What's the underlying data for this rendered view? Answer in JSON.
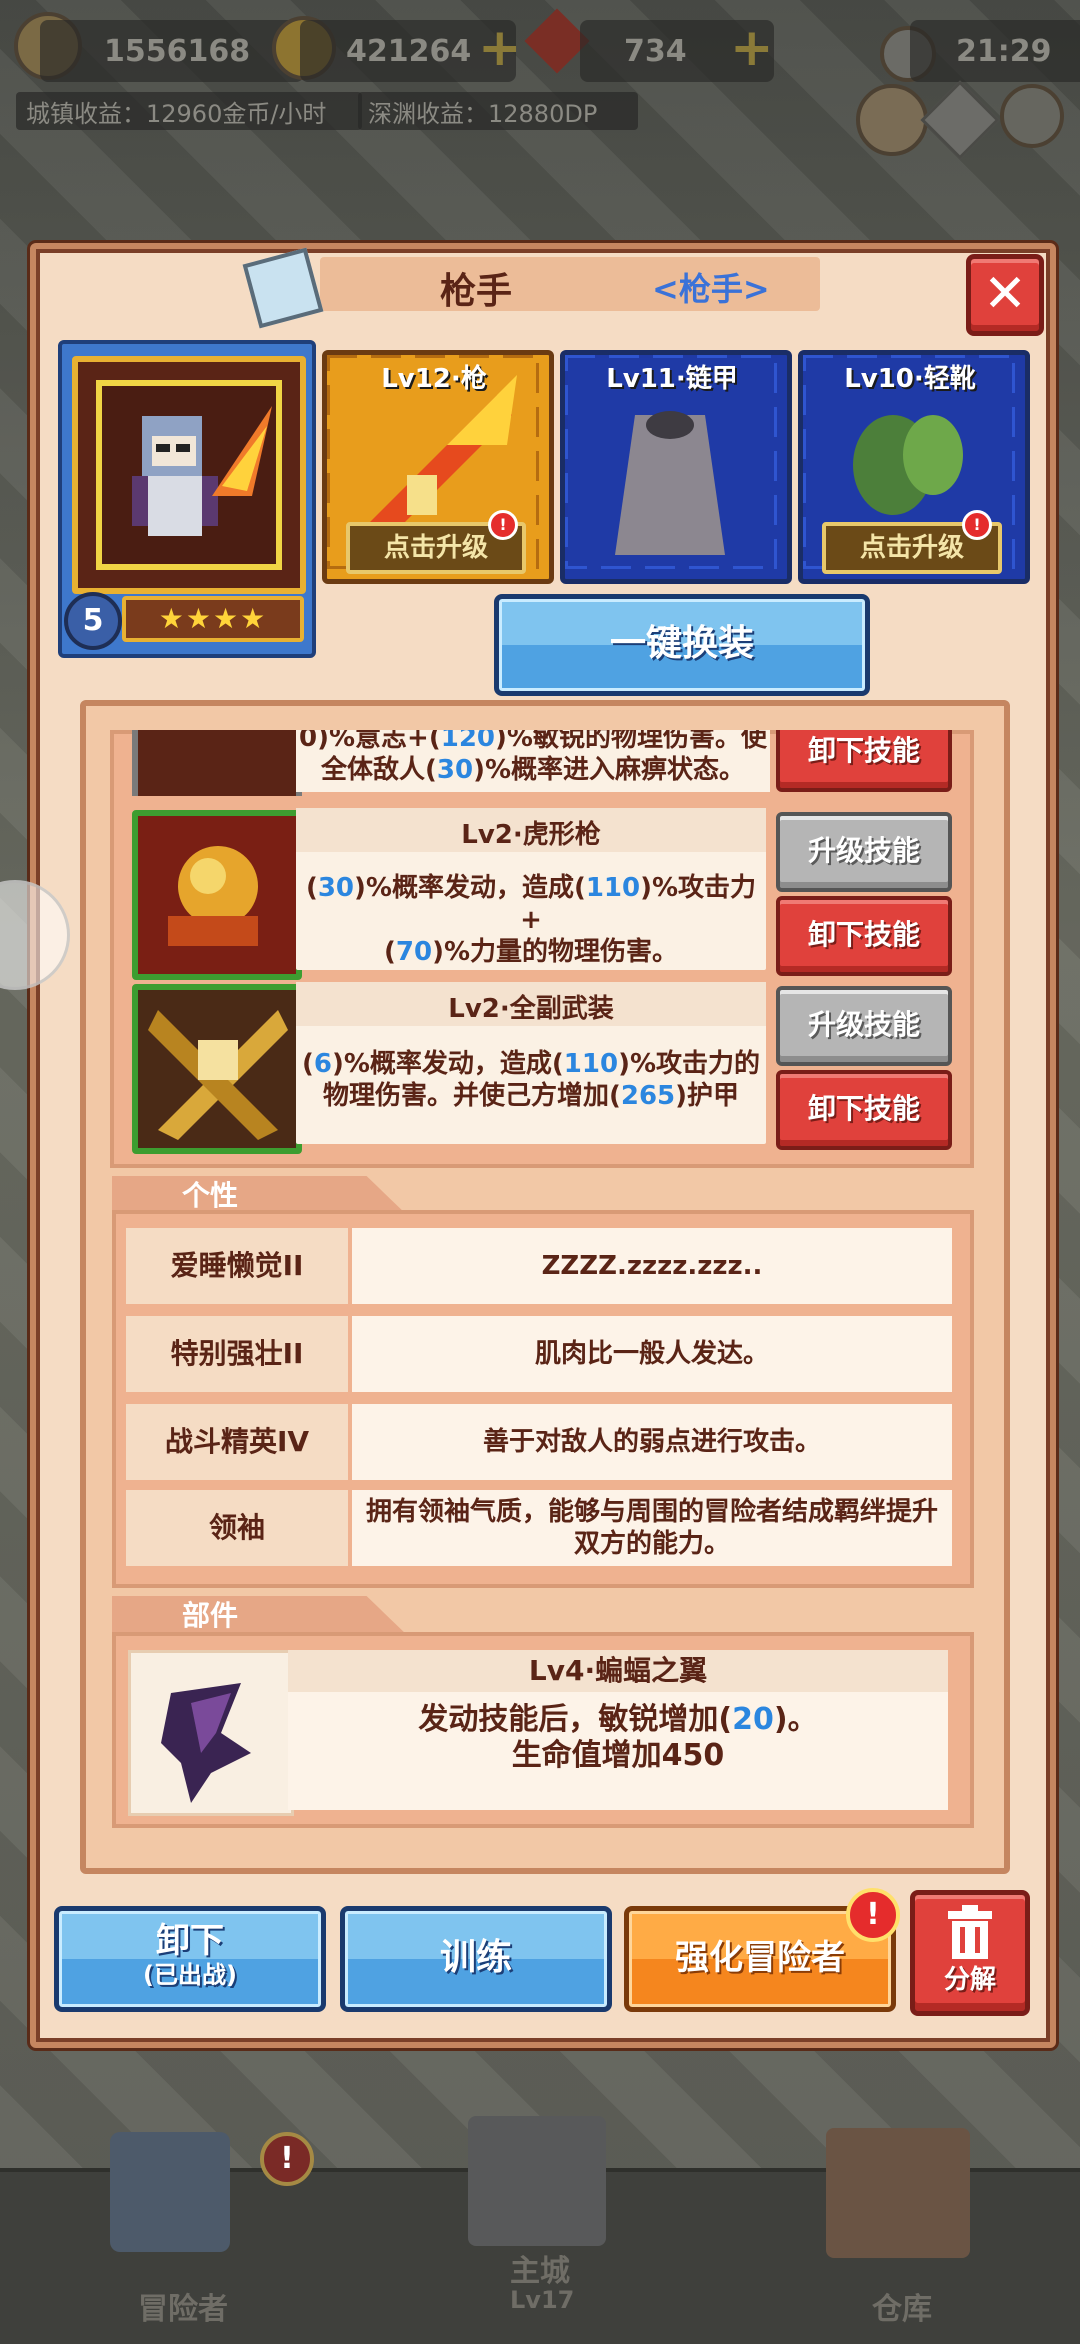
{
  "hud": {
    "gems_left": "1556168",
    "gold": "421264",
    "rubies": "734",
    "time": "21:29",
    "town_income": "城镇收益：12960金币/小时",
    "abyss_income": "深渊收益：12880DP"
  },
  "panel": {
    "title": "枪手",
    "subtitle": "<枪手>",
    "close": "✕",
    "hero_level": "5",
    "stars": "★★★★",
    "equipment": [
      {
        "label": "Lv12·枪",
        "upgrade": "点击升级"
      },
      {
        "label": "Lv11·链甲",
        "upgrade": ""
      },
      {
        "label": "Lv10·轻靴",
        "upgrade": "点击升级"
      }
    ],
    "equip_all": "一键换装",
    "skills": [
      {
        "name": "",
        "desc_parts": [
          "0)%意志+(",
          "120",
          ")%敏锐的物理伤害。使",
          "全体敌人(",
          "30",
          ")%概率进入麻痹状态。"
        ],
        "unequip": "卸下技能"
      },
      {
        "name": "Lv2·虎形枪",
        "desc_parts": [
          "(",
          "30",
          ")%概率发动，造成(",
          "110",
          ")%攻击力+",
          "(",
          "70",
          ")%力量的物理伤害。"
        ],
        "upgrade": "升级技能",
        "unequip": "卸下技能"
      },
      {
        "name": "Lv2·全副武装",
        "desc_parts": [
          "(",
          "6",
          ")%概率发动，造成(",
          "110",
          ")%攻击力的",
          "物理伤害。并使己方增加(",
          "265",
          ")护甲"
        ],
        "upgrade": "升级技能",
        "unequip": "卸下技能"
      }
    ],
    "traits_title": "个性",
    "traits": [
      {
        "name": "爱睡懒觉II",
        "desc": "ZZZZ.zzzz.zzz.."
      },
      {
        "name": "特别强壮II",
        "desc": "肌肉比一般人发达。"
      },
      {
        "name": "战斗精英IV",
        "desc": "善于对敌人的弱点进行攻击。"
      },
      {
        "name": "领袖",
        "desc": "拥有领袖气质，能够与周围的冒险者结成羁绊提升双方的能力。"
      }
    ],
    "parts_title": "部件",
    "part": {
      "name": "Lv4·蝙蝠之翼",
      "desc_a": "发动技能后，敏锐增加(",
      "desc_num": "20",
      "desc_b": ")。",
      "desc_line2": "生命值增加450"
    },
    "buttons": {
      "unequip": "卸下",
      "unequip_sub": "(已出战)",
      "train": "训练",
      "enhance": "强化冒险者",
      "decompose": "分解"
    }
  },
  "nav": {
    "adventurers": "冒险者",
    "main_city": "主城",
    "main_city_level": "Lv17",
    "warehouse": "仓库"
  },
  "colors": {
    "accent_blue": "#4fa2e2",
    "danger_red": "#e0413c",
    "enhance_orange": "#f5861e",
    "number_blue": "#2b86df"
  }
}
